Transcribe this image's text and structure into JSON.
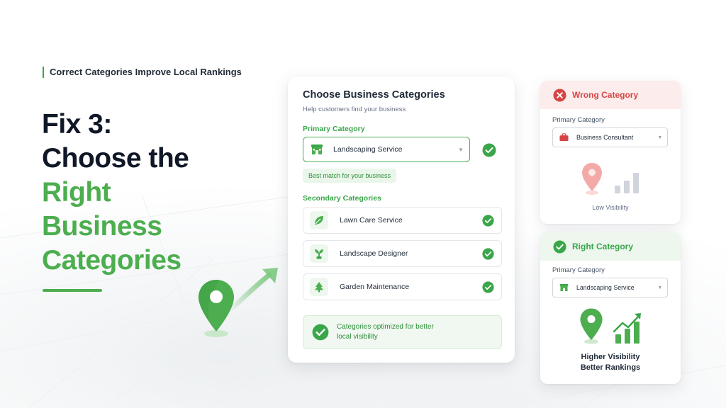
{
  "eyebrow": "Correct Categories Improve Local Rankings",
  "hero": {
    "line1": "Fix 3:",
    "line2": "Choose the",
    "line3": "Right",
    "line4": "Business",
    "line5": "Categories"
  },
  "main_card": {
    "title": "Choose Business Categories",
    "subtitle": "Help customers find your business",
    "primary_label": "Primary Category",
    "primary_value": "Landscaping Service",
    "hint": "Best match for your business",
    "secondary_label": "Secondary Categories",
    "secondary_items": [
      {
        "label": "Lawn Care Service",
        "icon": "leaf-icon"
      },
      {
        "label": "Landscape Designer",
        "icon": "sprout-icon"
      },
      {
        "label": "Garden Maintenance",
        "icon": "tree-icon"
      }
    ],
    "optimized_text": "Categories optimized for better local visibility"
  },
  "wrong_card": {
    "header": "Wrong Category",
    "primary_label": "Primary Category",
    "primary_value": "Business Consultant",
    "caption": "Low Visibility"
  },
  "right_card": {
    "header": "Right Category",
    "primary_label": "Primary Category",
    "primary_value": "Landscaping Service",
    "caption_line1": "Higher Visibility",
    "caption_line2": "Better Rankings"
  },
  "colors": {
    "accent_green": "#4cae4f",
    "error_red": "#d64545",
    "text_dark": "#101828"
  }
}
